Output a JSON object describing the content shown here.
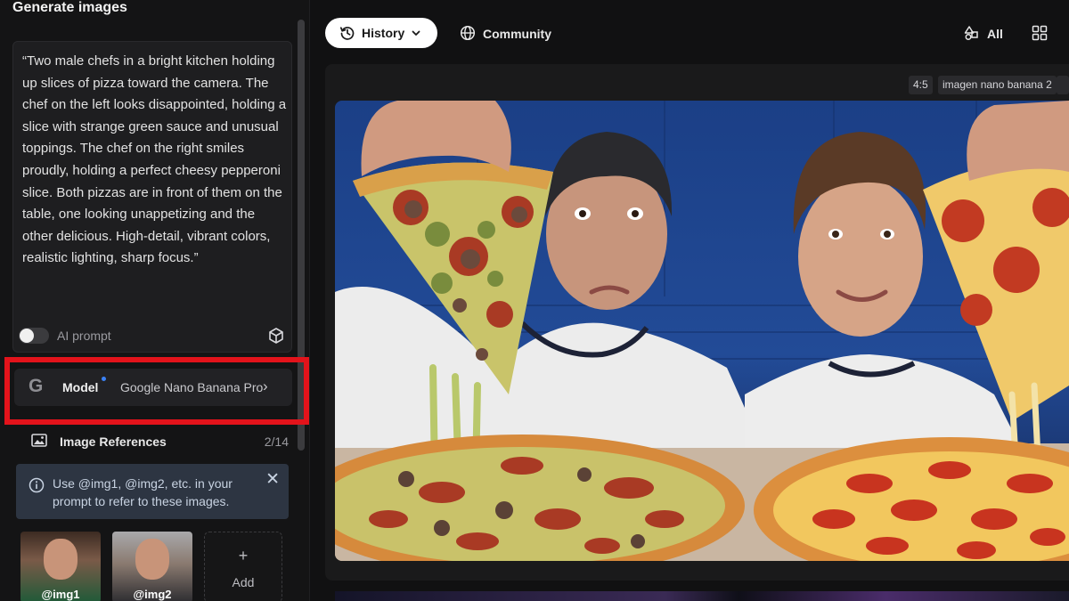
{
  "sidebar": {
    "title": "Generate images",
    "prompt_text": "“Two male chefs in a bright kitchen holding up slices of pizza toward the camera. The chef on the left looks disappointed, holding a slice with strange green sauce and unusual toppings. The chef on the right smiles proudly, holding a perfect cheesy pepperoni slice. Both pizzas are in front of them on the table, one looking unappetizing and the other delicious. High-detail, vibrant colors, realistic lighting, sharp focus.”",
    "ai_prompt_label": "AI prompt",
    "ai_prompt_enabled": false,
    "model": {
      "icon": "google-g-icon",
      "label": "Model",
      "value": "Google Nano Banana Pro",
      "badge_color": "#3b82f6"
    },
    "highlight_color": "#e3131b",
    "image_references": {
      "label": "Image References",
      "count": "2/14"
    },
    "info": {
      "text": "Use @img1, @img2, etc. in your prompt to refer to these images."
    },
    "thumbnails": [
      {
        "label": "@img1"
      },
      {
        "label": "@img2"
      }
    ],
    "add_label": "Add",
    "add_symbol": "+"
  },
  "topbar": {
    "history_label": "History",
    "community_label": "Community",
    "filter_label": "All"
  },
  "result": {
    "aspect_ratio": "4:5",
    "model_tag": "imagen nano banana 2",
    "image_alt": "Two chefs holding pizza slices, one disappointed with green-sauce pizza, one smiling with pepperoni pizza"
  }
}
